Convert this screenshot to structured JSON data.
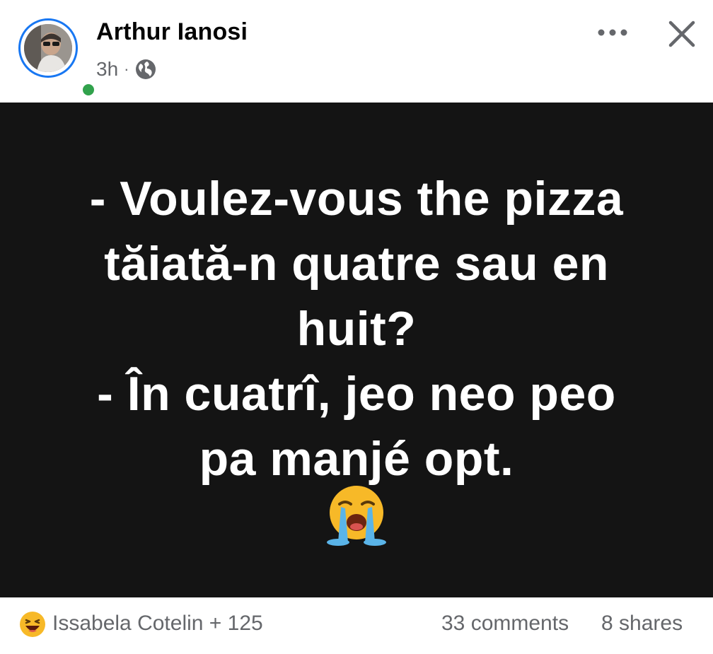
{
  "post": {
    "author": "Arthur Ianosi",
    "time": "3h",
    "separator": "·",
    "audience_icon": "globe-icon",
    "header_icons": [
      "more-options-icon",
      "close-icon"
    ],
    "text_lines": [
      "- Voulez-vous the pizza",
      "tăiată-n quatre sau en",
      "huit?",
      "- În cuatrî, jeo neo peo",
      "pa manjé opt."
    ],
    "emoji": "loudly-crying-face-emoji"
  },
  "footer": {
    "reaction_icon": "haha-reaction-icon",
    "reactors": "Issabela Cotelin + 125",
    "comments": "33 comments",
    "shares": "8 shares"
  },
  "colors": {
    "brand_blue": "#1877f2",
    "online_green": "#31a24c",
    "post_background": "#141414",
    "secondary_text": "#65676b",
    "haha_yellow": "#f7b928"
  }
}
